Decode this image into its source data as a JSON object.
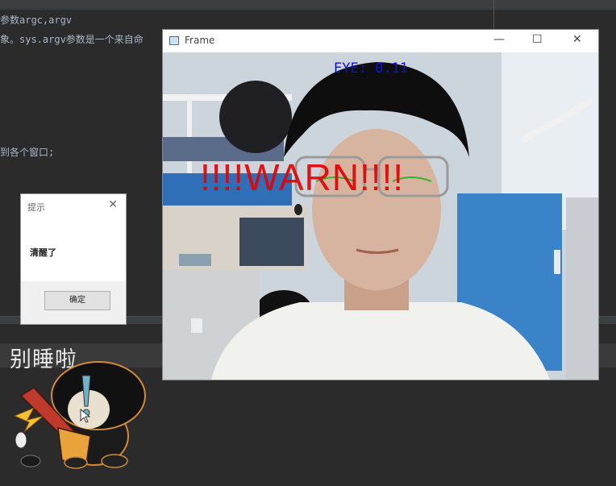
{
  "ide": {
    "line1": "参数argc,argv",
    "line2": "象。sys.argv参数是一个来自命",
    "line3": "到各个窗口;",
    "caption": "别睡啦"
  },
  "dialog": {
    "title": "提示",
    "close": "✕",
    "message": "清醒了",
    "ok_label": "确定"
  },
  "frame": {
    "title": "Frame",
    "minimize": "—",
    "maximize": "☐",
    "close": "✕",
    "eye_label": "EYE: 0.11",
    "warn_label": "!!!!WARN!!!!"
  },
  "colors": {
    "eye_text": "#1010e0",
    "warn_text": "#e80000",
    "ide_bg": "#2b2b2b"
  }
}
